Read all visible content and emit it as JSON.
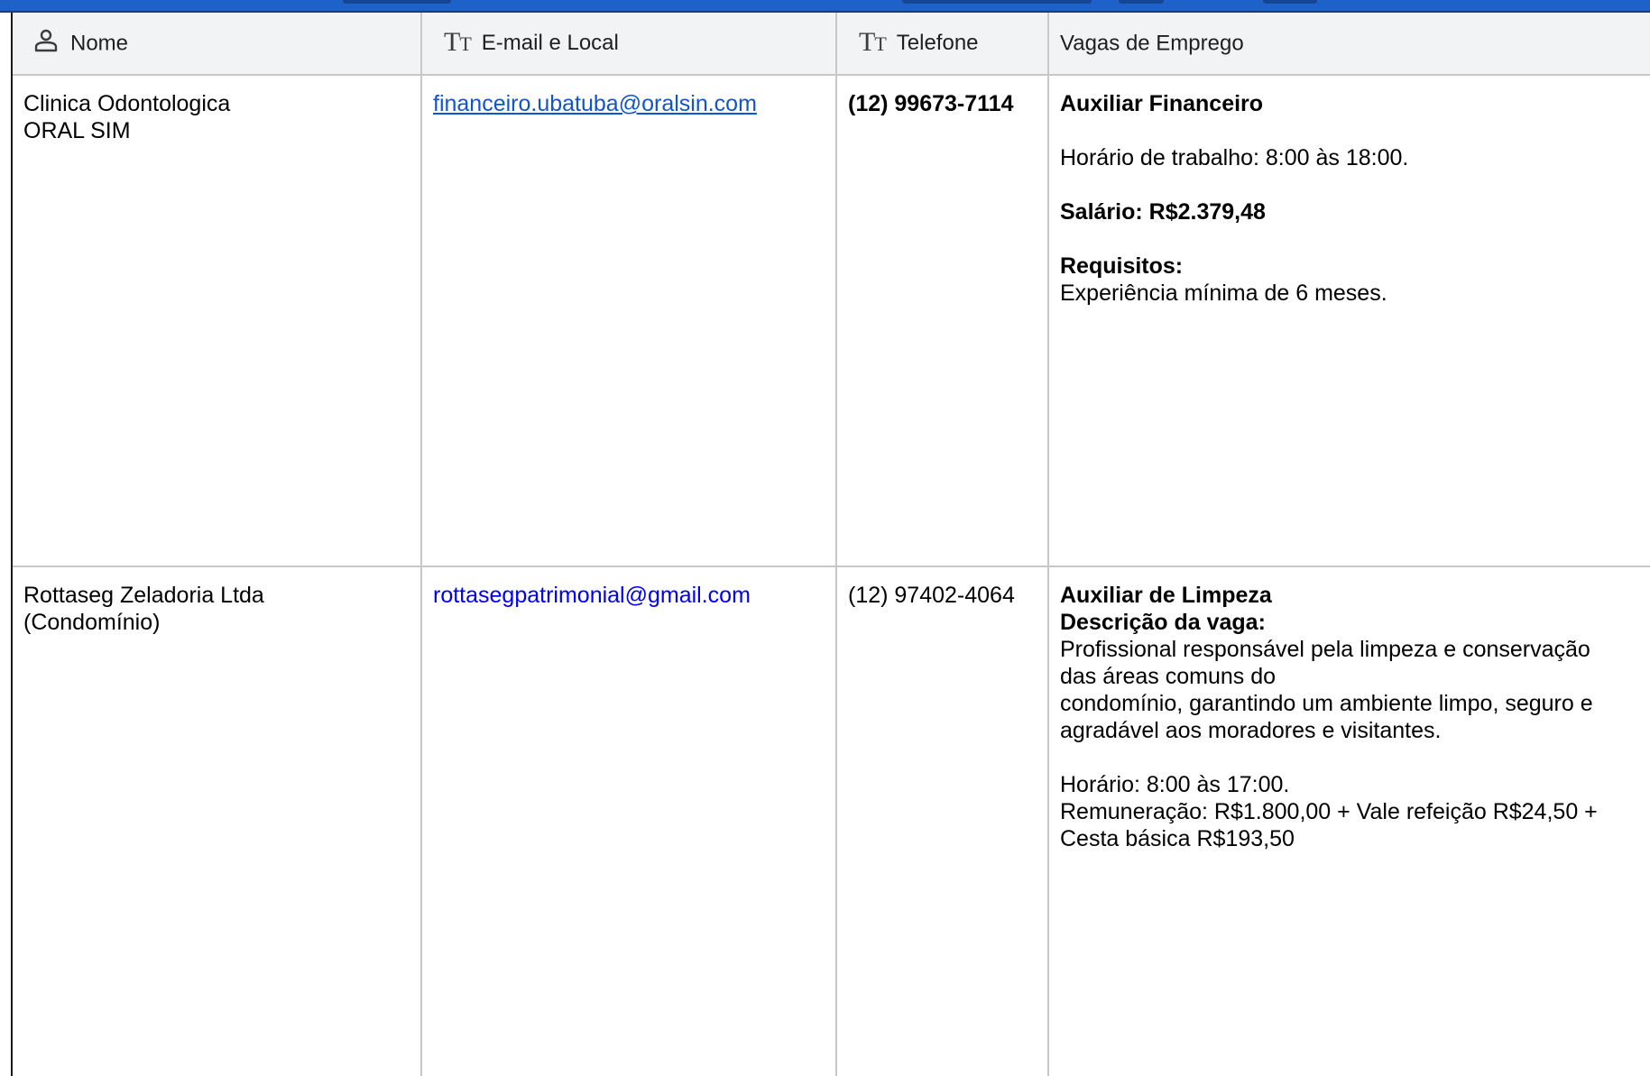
{
  "table": {
    "columns": [
      {
        "label": "Nome",
        "icon": "person-icon"
      },
      {
        "label": "E-mail e Local",
        "icon": "text-type-icon"
      },
      {
        "label": "Telefone",
        "icon": "text-type-icon"
      },
      {
        "label": "Vagas de Emprego",
        "icon": ""
      }
    ],
    "rows": [
      {
        "name_lines": [
          "Clinica Odontologica",
          "ORAL SIM"
        ],
        "email": "financeiro.ubatuba@oralsin.com",
        "phone": "(12) 99673-7114",
        "job": {
          "title": "Auxiliar Financeiro",
          "schedule": "Horário de trabalho: 8:00 às 18:00.",
          "salary": "Salário: R$2.379,48",
          "requirements_label": "Requisitos:",
          "requirements": "Experiência mínima de 6 meses."
        }
      },
      {
        "name_lines": [
          "Rottaseg Zeladoria Ltda",
          "(Condomínio)"
        ],
        "email": "rottasegpatrimonial@gmail.com",
        "phone": "(12) 97402-4064",
        "job": {
          "title": "Auxiliar de Limpeza",
          "description_label": "Descrição da vaga:",
          "description_lines": [
            "Profissional responsável pela limpeza e conservação",
            "das áreas comuns do",
            "condomínio, garantindo um ambiente limpo, seguro e",
            "agradável aos moradores e visitantes."
          ],
          "schedule": "Horário: 8:00 às 17:00.",
          "pay_lines": [
            "Remuneração: R$1.800,00 + Vale refeição R$24,50 +",
            "Cesta básica R$193,50"
          ]
        }
      }
    ]
  },
  "colors": {
    "top_band": "#1e62c9",
    "header_bg": "#f1f3f4",
    "grid_line": "#c7c7c7",
    "link": "#1155cc"
  }
}
